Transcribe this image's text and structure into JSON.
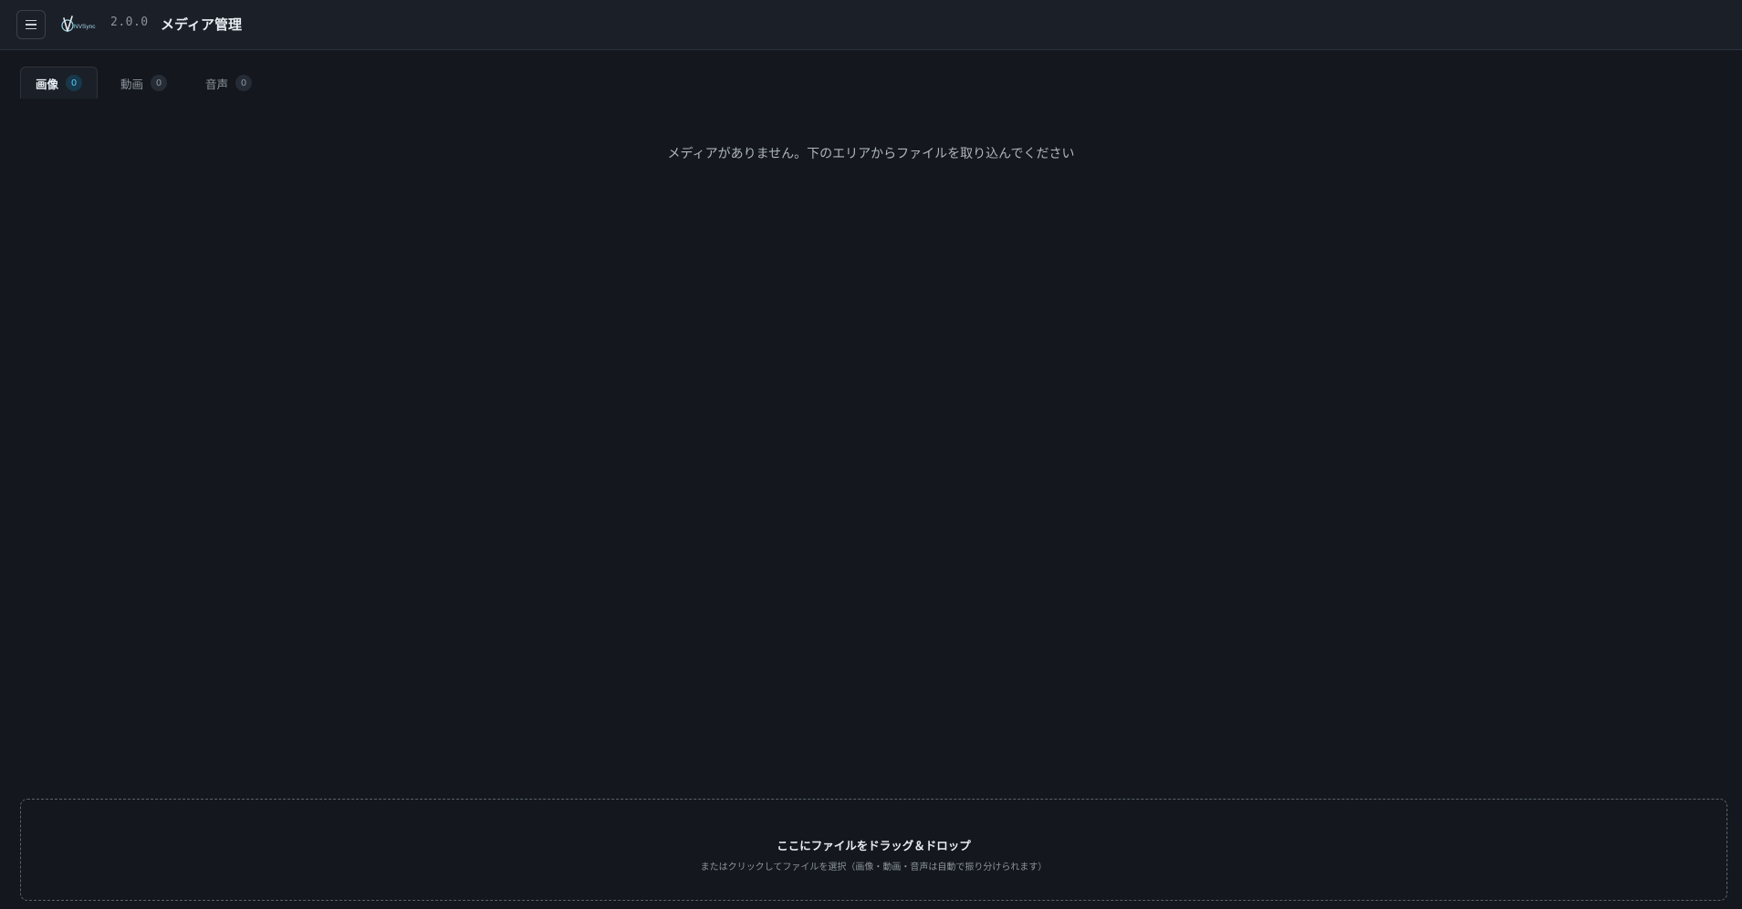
{
  "header": {
    "logo_text": "NVSync",
    "version": "2.0.0",
    "title": "メディア管理",
    "menu_icon": "hamburger-menu-icon"
  },
  "tabs": [
    {
      "label": "画像",
      "count": "0",
      "active": true
    },
    {
      "label": "動画",
      "count": "0",
      "active": false
    },
    {
      "label": "音声",
      "count": "0",
      "active": false
    }
  ],
  "main": {
    "empty_message": "メディアがありません。下のエリアからファイルを取り込んでください"
  },
  "dropzone": {
    "title": "ここにファイルをドラッグ＆ドロップ",
    "subtitle": "またはクリックしてファイルを選択（画像・動画・音声は自動で振り分けられます）"
  },
  "colors": {
    "background": "#14171d",
    "header_bg": "#1b1f27",
    "accent": "#58c4f5"
  }
}
